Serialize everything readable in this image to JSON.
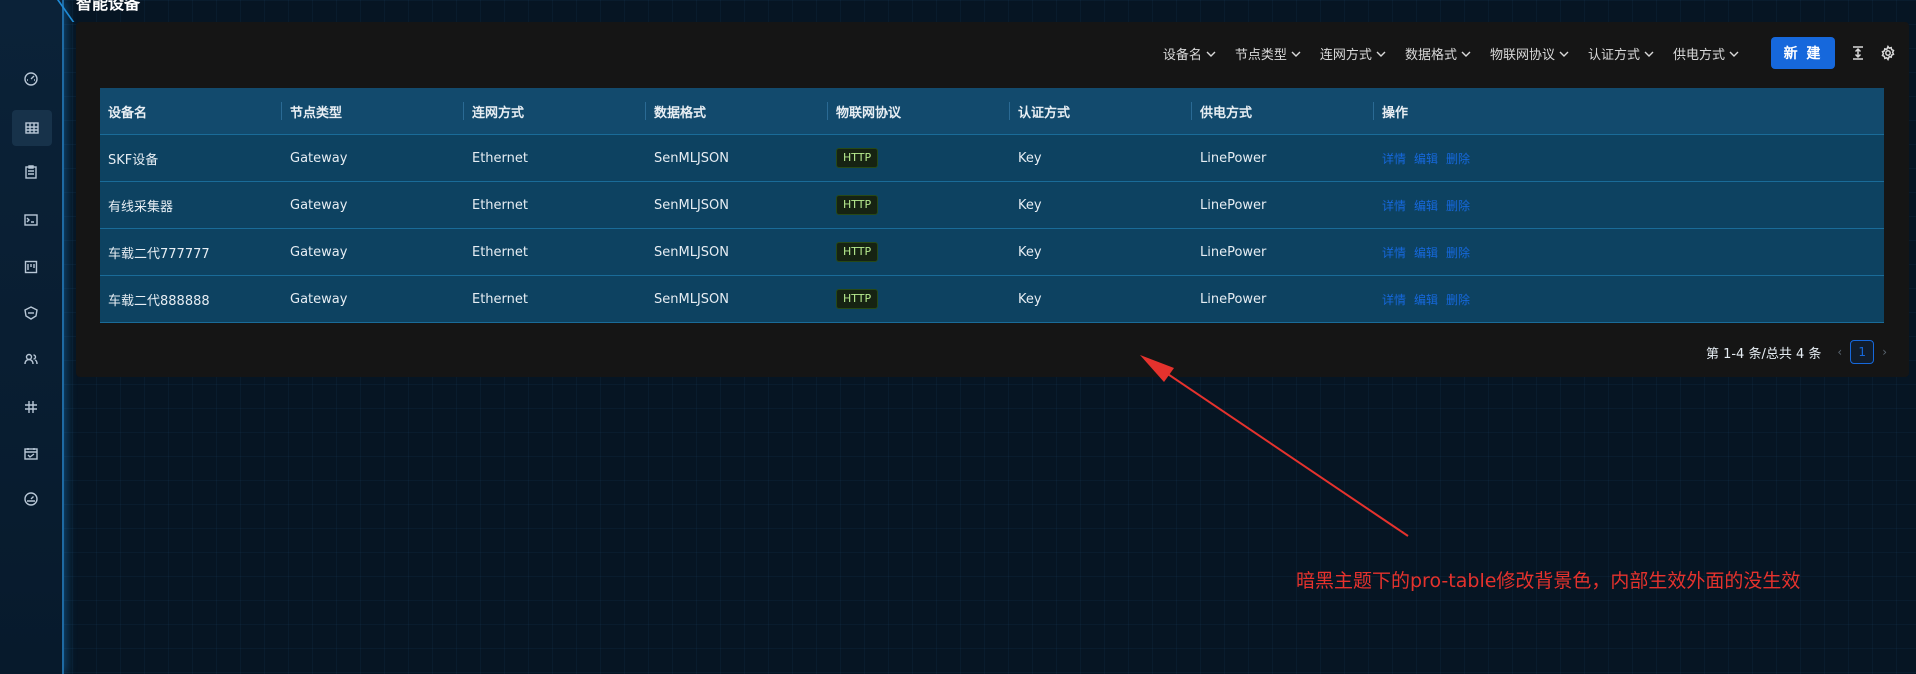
{
  "page": {
    "title": "智能设备"
  },
  "toolbar": {
    "filters": [
      "设备名",
      "节点类型",
      "连网方式",
      "数据格式",
      "物联网协议",
      "认证方式",
      "供电方式"
    ],
    "new_label": "新 建",
    "density_icon": "column-height-icon",
    "settings_icon": "gear-icon"
  },
  "table": {
    "columns": [
      "设备名",
      "节点类型",
      "连网方式",
      "数据格式",
      "物联网协议",
      "认证方式",
      "供电方式",
      "操作"
    ],
    "rows": [
      {
        "name": "SKF设备",
        "node": "Gateway",
        "net": "Ethernet",
        "format": "SenMLJSON",
        "protocol": "HTTP",
        "auth": "Key",
        "power": "LinePower"
      },
      {
        "name": "有线采集器",
        "node": "Gateway",
        "net": "Ethernet",
        "format": "SenMLJSON",
        "protocol": "HTTP",
        "auth": "Key",
        "power": "LinePower"
      },
      {
        "name": "车载二代777777",
        "node": "Gateway",
        "net": "Ethernet",
        "format": "SenMLJSON",
        "protocol": "HTTP",
        "auth": "Key",
        "power": "LinePower"
      },
      {
        "name": "车载二代888888",
        "node": "Gateway",
        "net": "Ethernet",
        "format": "SenMLJSON",
        "protocol": "HTTP",
        "auth": "Key",
        "power": "LinePower"
      }
    ],
    "actions": {
      "detail": "详情",
      "edit": "编辑",
      "delete": "删除"
    }
  },
  "pagination": {
    "summary": "第 1-4 条/总共 4 条",
    "current": "1"
  },
  "annotation": {
    "text": "暗黑主题下的pro-table修改背景色，内部生效外面的没生效",
    "color": "#e5322d"
  },
  "colors": {
    "accent": "#1668dc",
    "header_bg": "#124a6d",
    "row_bg": "#0d4261",
    "card_bg": "#151515"
  },
  "sidebar": {
    "icons": [
      "dashboard-icon",
      "table-icon",
      "clipboard-icon",
      "terminal-icon",
      "board-icon",
      "shield-icon",
      "users-icon",
      "slack-icon",
      "calendar-icon",
      "gauge-icon"
    ]
  }
}
